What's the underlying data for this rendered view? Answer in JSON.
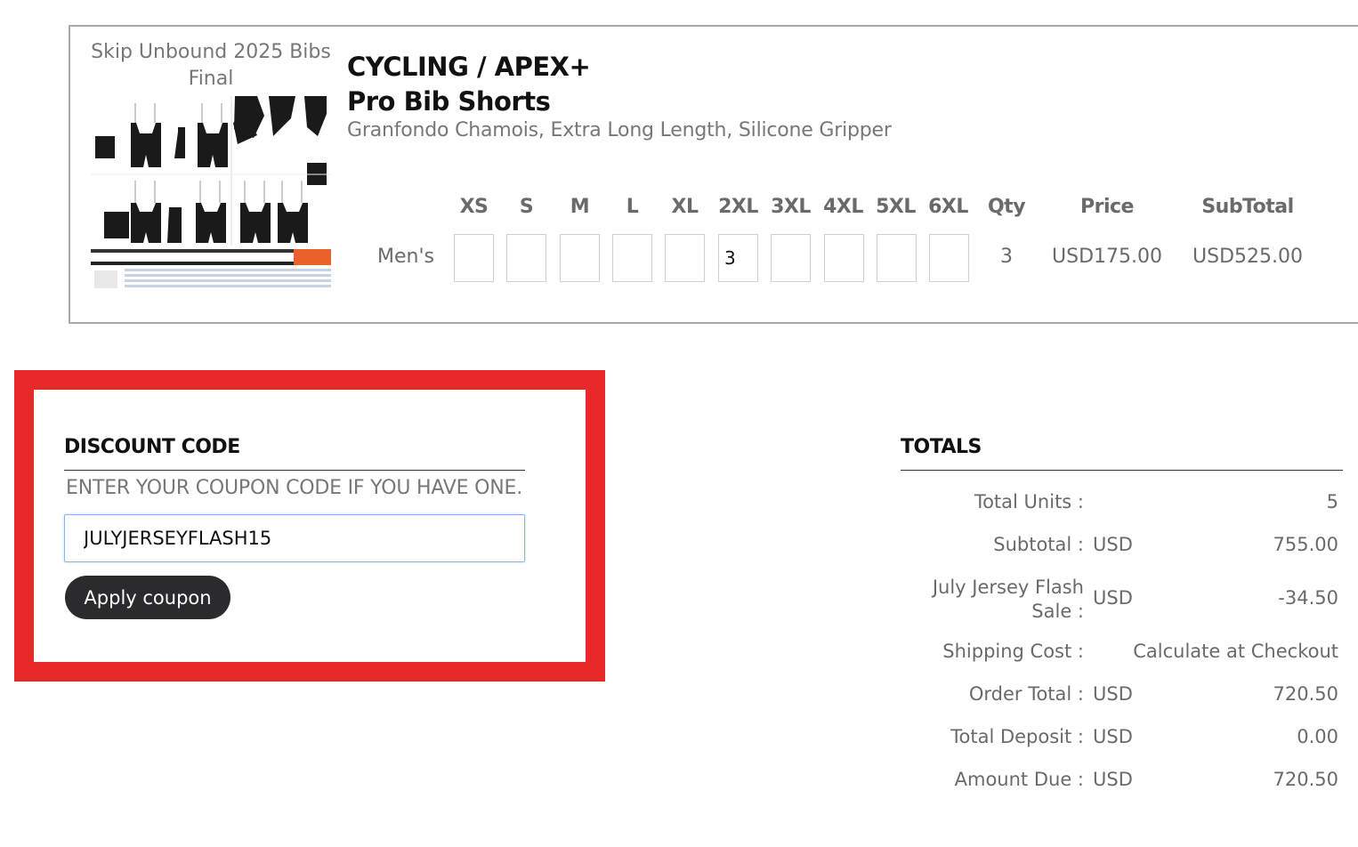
{
  "product": {
    "design_name": "Skip Unbound 2025 Bibs Final",
    "title_line1": "CYCLING / APEX+",
    "title_line2": "Pro Bib Shorts",
    "features": "Granfondo Chamois, Extra Long Length, Silicone Gripper",
    "sizes": [
      "XS",
      "S",
      "M",
      "L",
      "XL",
      "2XL",
      "3XL",
      "4XL",
      "5XL",
      "6XL"
    ],
    "qty_header": "Qty",
    "price_header": "Price",
    "subtotal_header": "SubTotal",
    "row_label": "Men's",
    "quantities": [
      "",
      "",
      "",
      "",
      "",
      "3",
      "",
      "",
      "",
      ""
    ],
    "qty": "3",
    "price": "USD175.00",
    "subtotal": "USD525.00"
  },
  "discount": {
    "title": "DISCOUNT CODE",
    "help": "ENTER YOUR COUPON CODE IF YOU HAVE ONE.",
    "coupon_value": "JULYJERSEYFLASH15",
    "apply_label": "Apply coupon",
    "highlight_color": "#e8282b"
  },
  "totals": {
    "title": "TOTALS",
    "rows": [
      {
        "label": "Total Units :",
        "currency": "",
        "value": "5"
      },
      {
        "label": "Subtotal :",
        "currency": "USD",
        "value": "755.00"
      },
      {
        "label": "July Jersey Flash Sale :",
        "currency": "USD",
        "value": "-34.50"
      },
      {
        "label": "Shipping Cost :",
        "currency": "",
        "value": "Calculate at Checkout"
      },
      {
        "label": "Order Total :",
        "currency": "USD",
        "value": "720.50"
      },
      {
        "label": "Total Deposit :",
        "currency": "USD",
        "value": "0.00"
      },
      {
        "label": "Amount Due :",
        "currency": "USD",
        "value": "720.50"
      }
    ]
  }
}
